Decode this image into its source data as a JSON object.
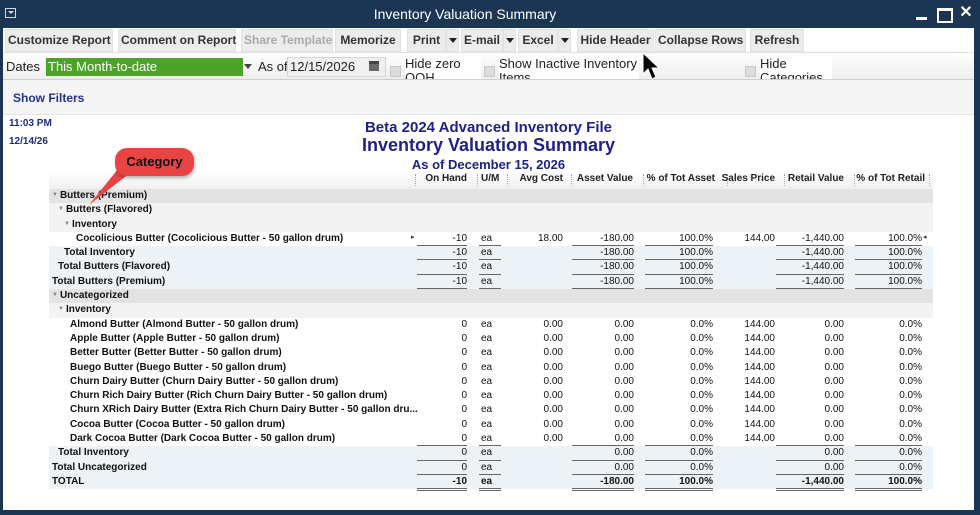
{
  "window": {
    "title": "Inventory Valuation Summary"
  },
  "toolbar": {
    "customize": "Customize Report",
    "comment": "Comment on Report",
    "share": "Share Template",
    "memorize": "Memorize",
    "print": "Print",
    "email": "E-mail",
    "excel": "Excel",
    "hide_header": "Hide Header",
    "collapse": "Collapse Rows",
    "refresh": "Refresh"
  },
  "filters": {
    "dates_label": "Dates",
    "dates_value": "This Month-to-date",
    "asof_label": "As of",
    "asof_value": "12/15/2026",
    "hide_zero": "Hide zero QOH",
    "show_inactive": "Show Inactive Inventory Items",
    "hide": "Hide Categories",
    "show_filters": "Show Filters"
  },
  "report": {
    "time": "11:03 PM",
    "date": "12/14/26",
    "company": "Beta 2024 Advanced Inventory File",
    "title": "Inventory Valuation Summary",
    "subtitle": "As of December 15, 2026",
    "callout": "Category",
    "columns": [
      "On Hand",
      "U/M",
      "Avg Cost",
      "Asset Value",
      "% of Tot Asset",
      "Sales Price",
      "Retail Value",
      "% of Tot Retail"
    ],
    "rows": [
      {
        "type": "cat",
        "indent": 0,
        "collapsible": true,
        "name": "Butters (Premium)",
        "values": [
          "",
          "",
          "",
          "",
          "",
          "",
          "",
          ""
        ]
      },
      {
        "type": "grp",
        "indent": 1,
        "collapsible": true,
        "name": "Butters (Flavored)",
        "values": [
          "",
          "",
          "",
          "",
          "",
          "",
          "",
          ""
        ]
      },
      {
        "type": "grp",
        "indent": 2,
        "collapsible": true,
        "name": "Inventory",
        "values": [
          "",
          "",
          "",
          "",
          "",
          "",
          "",
          ""
        ]
      },
      {
        "type": "item",
        "indent": 3,
        "name": "Cocolicious Butter (Cocolicious Butter - 50 gallon drum)",
        "selected": true,
        "values": [
          "-10",
          "ea",
          "18.00",
          "-180.00",
          "100.0%",
          "144.00",
          "-1,440.00",
          "100.0%"
        ]
      },
      {
        "type": "tot",
        "indent": 2,
        "name": "Total Inventory",
        "values": [
          "-10",
          "ea",
          "",
          "-180.00",
          "100.0%",
          "",
          "-1,440.00",
          "100.0%"
        ]
      },
      {
        "type": "tot",
        "indent": 1,
        "name": "Total Butters (Flavored)",
        "values": [
          "-10",
          "ea",
          "",
          "-180.00",
          "100.0%",
          "",
          "-1,440.00",
          "100.0%"
        ]
      },
      {
        "type": "tot",
        "indent": 0,
        "name": "Total Butters (Premium)",
        "values": [
          "-10",
          "ea",
          "",
          "-180.00",
          "100.0%",
          "",
          "-1,440.00",
          "100.0%"
        ]
      },
      {
        "type": "cat",
        "indent": 0,
        "collapsible": true,
        "name": "Uncategorized",
        "values": [
          "",
          "",
          "",
          "",
          "",
          "",
          "",
          ""
        ]
      },
      {
        "type": "grp",
        "indent": 1,
        "collapsible": true,
        "name": "Inventory",
        "values": [
          "",
          "",
          "",
          "",
          "",
          "",
          "",
          ""
        ]
      },
      {
        "type": "item",
        "indent": 2,
        "name": "Almond Butter (Almond Butter - 50 gallon drum)",
        "values": [
          "0",
          "ea",
          "0.00",
          "0.00",
          "0.0%",
          "144.00",
          "0.00",
          "0.0%"
        ]
      },
      {
        "type": "item",
        "indent": 2,
        "name": "Apple Butter (Apple Butter - 50 gallon drum)",
        "values": [
          "0",
          "ea",
          "0.00",
          "0.00",
          "0.0%",
          "144.00",
          "0.00",
          "0.0%"
        ]
      },
      {
        "type": "item",
        "indent": 2,
        "name": "Better Butter (Better Butter - 50 gallon drum)",
        "values": [
          "0",
          "ea",
          "0.00",
          "0.00",
          "0.0%",
          "144.00",
          "0.00",
          "0.0%"
        ]
      },
      {
        "type": "item",
        "indent": 2,
        "name": "Buego Butter (Buego Butter - 50 gallon drum)",
        "values": [
          "0",
          "ea",
          "0.00",
          "0.00",
          "0.0%",
          "144.00",
          "0.00",
          "0.0%"
        ]
      },
      {
        "type": "item",
        "indent": 2,
        "name": "Churn Dairy Butter (Churn Dairy Butter - 50 gallon drum)",
        "values": [
          "0",
          "ea",
          "0.00",
          "0.00",
          "0.0%",
          "144.00",
          "0.00",
          "0.0%"
        ]
      },
      {
        "type": "item",
        "indent": 2,
        "name": "Churn Rich Dairy Butter (Rich Churn Dairy Butter - 50 gallon drum)",
        "values": [
          "0",
          "ea",
          "0.00",
          "0.00",
          "0.0%",
          "144.00",
          "0.00",
          "0.0%"
        ]
      },
      {
        "type": "item",
        "indent": 2,
        "name": "Churn XRich Dairy Butter (Extra Rich Churn Dairy Butter - 50 gallon dru...",
        "values": [
          "0",
          "ea",
          "0.00",
          "0.00",
          "0.0%",
          "144.00",
          "0.00",
          "0.0%"
        ]
      },
      {
        "type": "item",
        "indent": 2,
        "name": "Cocoa Butter (Cocoa Butter - 50 gallon drum)",
        "values": [
          "0",
          "ea",
          "0.00",
          "0.00",
          "0.0%",
          "144.00",
          "0.00",
          "0.0%"
        ]
      },
      {
        "type": "item",
        "indent": 2,
        "name": "Dark Cocoa Butter (Dark Cocoa Butter - 50 gallon drum)",
        "values": [
          "0",
          "ea",
          "0.00",
          "0.00",
          "0.0%",
          "144.00",
          "0.00",
          "0.0%"
        ]
      },
      {
        "type": "tot",
        "indent": 1,
        "name": "Total Inventory",
        "values": [
          "0",
          "ea",
          "",
          "0.00",
          "0.0%",
          "",
          "0.00",
          "0.0%"
        ]
      },
      {
        "type": "tot",
        "indent": 0,
        "name": "Total Uncategorized",
        "values": [
          "0",
          "ea",
          "",
          "0.00",
          "0.0%",
          "",
          "0.00",
          "0.0%"
        ]
      },
      {
        "type": "grand",
        "indent": 0,
        "name": "TOTAL",
        "values": [
          "-10",
          "ea",
          "",
          "-180.00",
          "100.0%",
          "",
          "-1,440.00",
          "100.0%"
        ]
      }
    ]
  }
}
